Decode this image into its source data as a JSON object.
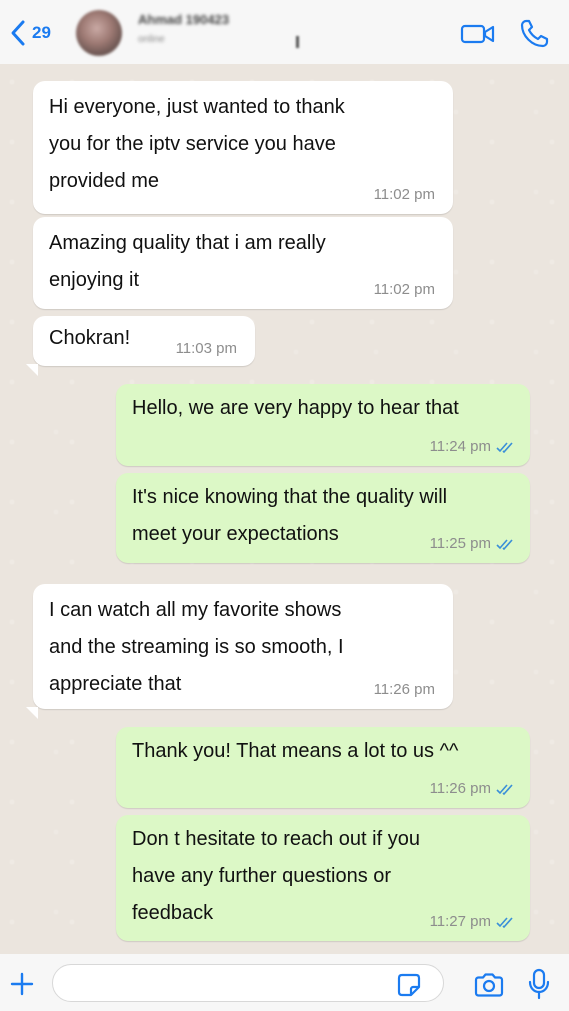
{
  "header": {
    "back_count": "29",
    "contact_name": "Ahmad 190423",
    "contact_status": "online"
  },
  "colors": {
    "accent": "#1b7bf0",
    "incoming_bubble": "#ffffff",
    "outgoing_bubble": "#dcf8c6",
    "chat_background": "#ebe5de",
    "read_ticks": "#3a8fd8"
  },
  "icons": {
    "back": "chevron-left-icon",
    "video": "video-camera-icon",
    "call": "phone-icon",
    "attach": "plus-icon",
    "sticker": "sticker-icon",
    "camera": "camera-icon",
    "mic": "microphone-icon",
    "read": "double-check-icon"
  },
  "messages": [
    {
      "direction": "in",
      "text": "Hi everyone, just wanted to thank\nyou for the iptv service you have\nprovided me",
      "time": "11:02 pm"
    },
    {
      "direction": "in",
      "text": "Amazing quality that i am really\nenjoying it",
      "time": "11:02 pm"
    },
    {
      "direction": "in",
      "text": "Chokran!",
      "time": "11:03 pm"
    },
    {
      "direction": "out",
      "text": "Hello, we are very happy to hear that",
      "time": "11:24 pm",
      "read": true
    },
    {
      "direction": "out",
      "text": "It's nice knowing that the quality will\nmeet your expectations",
      "time": "11:25 pm",
      "read": true
    },
    {
      "direction": "in",
      "text": "I can watch all my favorite shows\nand the streaming is so smooth, I\nappreciate that",
      "time": "11:26 pm"
    },
    {
      "direction": "out",
      "text": "Thank you! That means a lot to us ^^",
      "time": "11:26 pm",
      "read": true
    },
    {
      "direction": "out",
      "text": "Don t hesitate to reach out if you\nhave any further questions or\nfeedback",
      "time": "11:27 pm",
      "read": true
    }
  ],
  "composer": {
    "value": "",
    "placeholder": ""
  }
}
